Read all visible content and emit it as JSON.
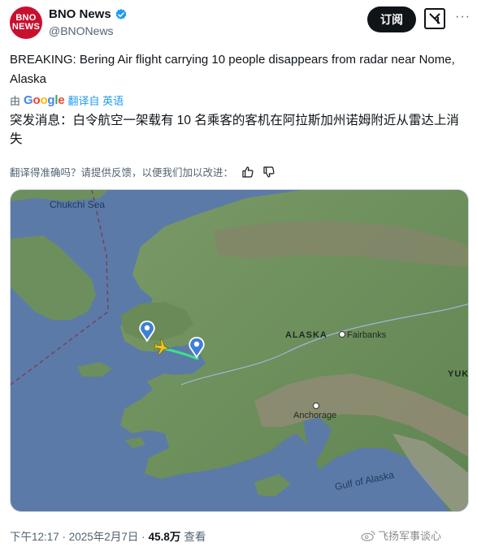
{
  "account": {
    "avatar_text_top": "BNO",
    "avatar_text_bottom": "NEWS",
    "display_name": "BNO News",
    "handle": "@BNONews"
  },
  "actions": {
    "subscribe_label": "订阅"
  },
  "tweet": {
    "text": "BREAKING: Bering Air flight carrying 10 people disappears from radar near Nome, Alaska"
  },
  "translation": {
    "by": "由",
    "google": "Google",
    "translated_from": "翻译自 英语",
    "text": "突发消息：白令航空一架载有 10 名乘客的客机在阿拉斯加州诺姆附近从雷达上消失",
    "feedback_prompt": "翻译得准确吗？请提供反馈，以便我们加以改进："
  },
  "map": {
    "labels": {
      "sea": "Chukchi Sea",
      "state": "ALASKA",
      "city1": "Fairbanks",
      "city2": "Anchorage",
      "gulf": "Gulf of Alaska",
      "edge": "YUK"
    },
    "colors": {
      "water": "#5b7aa8",
      "land": "#6d8f5e",
      "track": "#3de08a",
      "plane": "#f5c518",
      "marker": "#3f7fd6"
    }
  },
  "meta": {
    "time": "下午12:17 · 2025年2月7日 · ",
    "views": "45.8万",
    "views_label": "查看"
  },
  "watermark": {
    "text": "飞扬军事谈心"
  }
}
